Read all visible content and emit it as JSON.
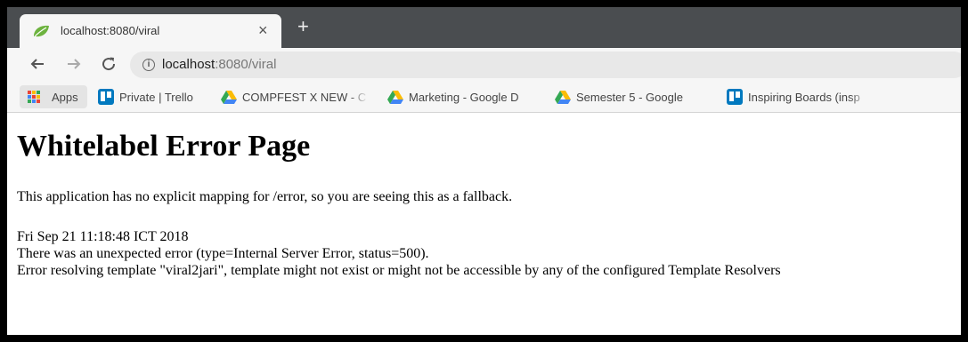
{
  "tab": {
    "title": "localhost:8080/viral",
    "close_glyph": "×",
    "new_tab_glyph": "+"
  },
  "toolbar": {
    "url_host": "localhost",
    "url_path": ":8080/viral",
    "info_glyph": "i"
  },
  "bookmarks": {
    "apps": "Apps",
    "items": [
      {
        "label": "Private | Trello",
        "icon": "trello-icon"
      },
      {
        "label": "COMPFEST X NEW - C",
        "icon": "google-drive-icon"
      },
      {
        "label": "Marketing - Google D",
        "icon": "google-drive-icon"
      },
      {
        "label": "Semester 5 - Google",
        "icon": "google-drive-icon"
      },
      {
        "label": "Inspiring Boards (insp",
        "icon": "trello-icon"
      }
    ]
  },
  "page": {
    "title": "Whitelabel Error Page",
    "message": "This application has no explicit mapping for /error, so you are seeing this as a fallback.",
    "timestamp": "Fri Sep 21 11:18:48 ICT 2018",
    "error_line": "There was an unexpected error (type=Internal Server Error, status=500).",
    "detail": "Error resolving template \"viral2jari\", template might not exist or might not be accessible by any of the configured Template Resolvers"
  },
  "colors": {
    "tab_strip": "#4a4d50",
    "toolbar": "#f6f6f6",
    "trello": "#0079bf",
    "spring_leaf": "#6db33f"
  }
}
